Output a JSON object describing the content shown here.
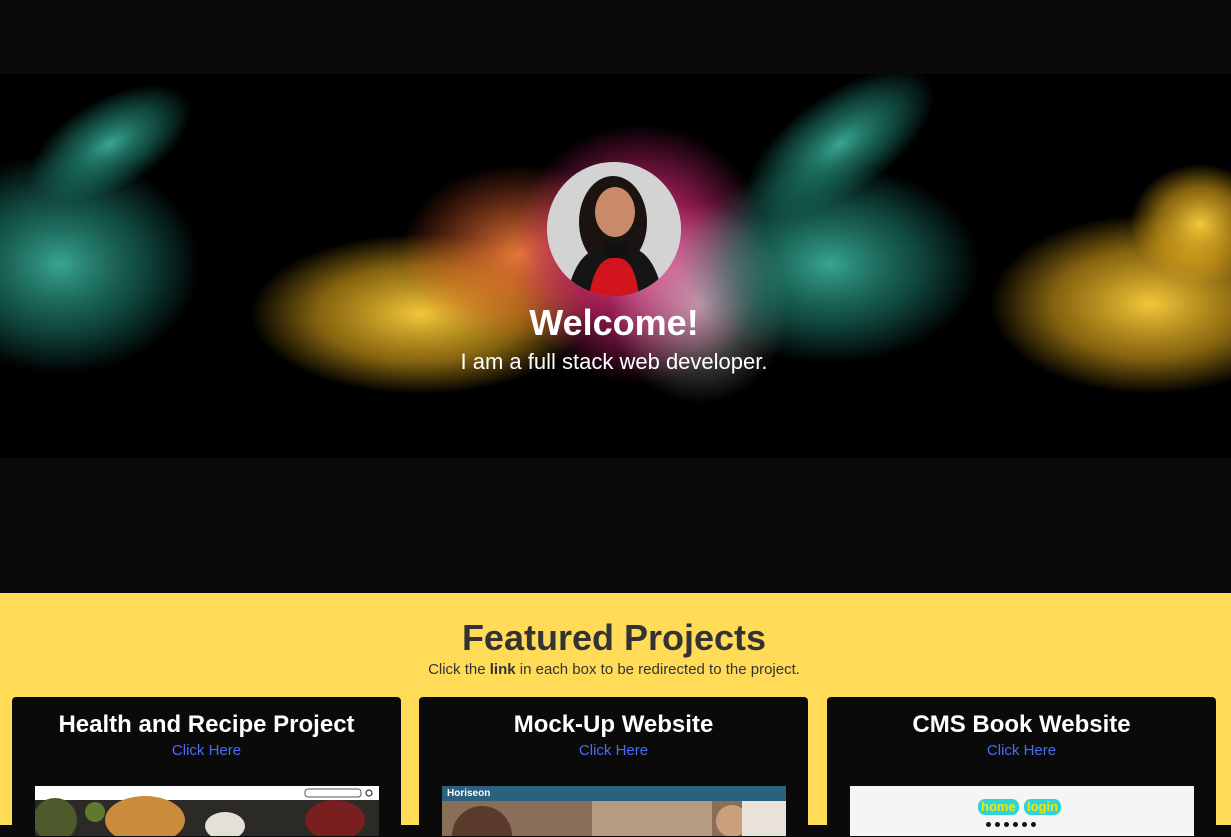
{
  "hero": {
    "title": "Welcome!",
    "subtitle": "I am a full stack web developer."
  },
  "projects": {
    "title": "Featured Projects",
    "desc_before": "Click the ",
    "desc_bold": "link",
    "desc_after": " in each box to be redirected to the project.",
    "cards": [
      {
        "title": "Health and Recipe Project",
        "link": "Click Here"
      },
      {
        "title": "Mock-Up Website",
        "link": "Click Here",
        "thumb_brand": "Horiseon"
      },
      {
        "title": "CMS Book Website",
        "link": "Click Here",
        "thumb_buttons": [
          "home",
          "login"
        ]
      }
    ]
  },
  "colors": {
    "background": "#0a0a0a",
    "accent_yellow": "#ffdb58",
    "link_blue": "#4a6cf7",
    "heading_dark": "#333333"
  }
}
